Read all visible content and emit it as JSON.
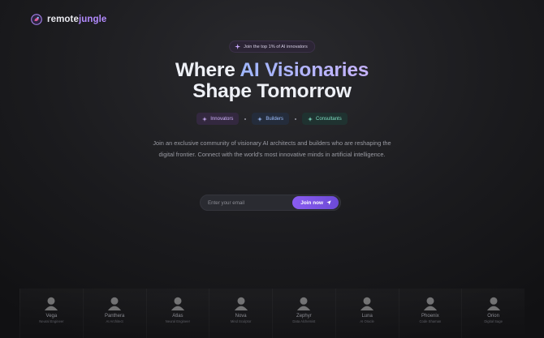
{
  "brand": {
    "name_part1": "remote",
    "name_part2": "jungle",
    "accent": "#b38bff"
  },
  "badge": {
    "icon": "sparkle-icon",
    "text": "Join the top 1% of AI innovators"
  },
  "headline": {
    "line1_plain": "Where ",
    "line1_accent": "AI Visionaries",
    "line2": "Shape Tomorrow"
  },
  "tags": [
    {
      "label": "Innovators",
      "icon": "sparkle-icon",
      "color": "#d2b5ff"
    },
    {
      "label": "Builders",
      "icon": "sparkle-icon",
      "color": "#9fc0ff"
    },
    {
      "label": "Consultants",
      "icon": "sparkle-icon",
      "color": "#7fe0c3"
    }
  ],
  "description": "Join an exclusive community of visionary AI architects and builders who are reshaping the digital frontier. Connect with the world's most innovative minds in artificial intelligence.",
  "signup": {
    "placeholder": "Enter your email",
    "button_label": "Join now",
    "button_icon": "send-icon",
    "button_color": "#8a5cf0"
  },
  "people": [
    {
      "name": "Vega",
      "role": "Neural Engineer"
    },
    {
      "name": "Panthera",
      "role": "AI Architect"
    },
    {
      "name": "Atlas",
      "role": "Neural Engineer"
    },
    {
      "name": "Nova",
      "role": "Mind Sculptor"
    },
    {
      "name": "Zephyr",
      "role": "Data Alchemist"
    },
    {
      "name": "Luna",
      "role": "AI Oracle"
    },
    {
      "name": "Phoenix",
      "role": "Code Shaman"
    },
    {
      "name": "Orion",
      "role": "Digital Sage"
    }
  ]
}
